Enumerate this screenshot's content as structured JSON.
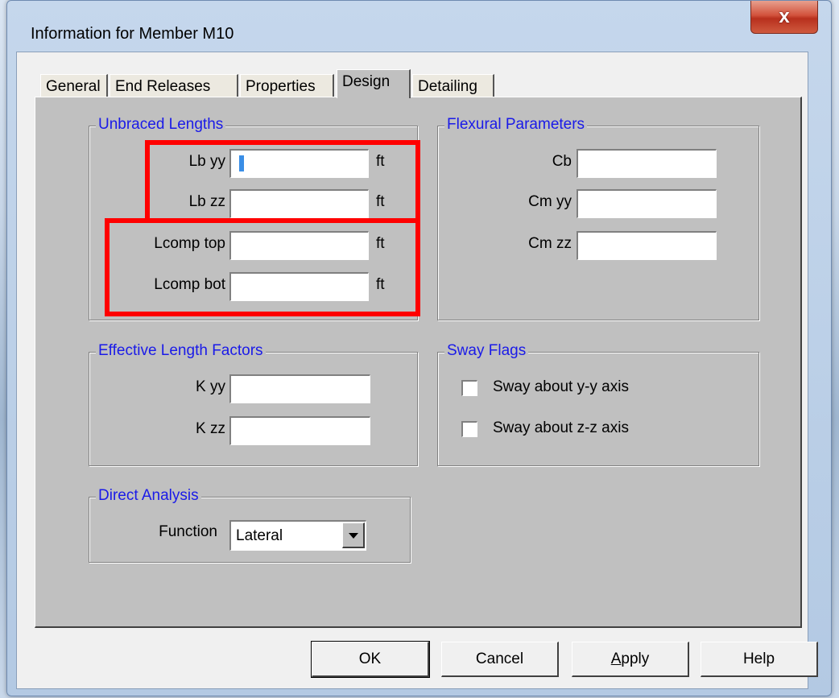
{
  "window": {
    "title": "Information for Member M10",
    "close_glyph": "x"
  },
  "tabs": [
    {
      "label": "General"
    },
    {
      "label": "End Releases"
    },
    {
      "label": "Properties"
    },
    {
      "label": "Design",
      "active": true
    },
    {
      "label": "Detailing"
    }
  ],
  "unbraced": {
    "title": "Unbraced Lengths",
    "lb_yy": {
      "label": "Lb yy",
      "value": "",
      "unit": "ft"
    },
    "lb_zz": {
      "label": "Lb zz",
      "value": "",
      "unit": "ft"
    },
    "lcomp_top": {
      "label": "Lcomp top",
      "value": "",
      "unit": "ft"
    },
    "lcomp_bot": {
      "label": "Lcomp bot",
      "value": "",
      "unit": "ft"
    }
  },
  "flexural": {
    "title": "Flexural Parameters",
    "cb": {
      "label": "Cb",
      "value": ""
    },
    "cm_yy": {
      "label": "Cm yy",
      "value": ""
    },
    "cm_zz": {
      "label": "Cm zz",
      "value": ""
    }
  },
  "effective": {
    "title": "Effective Length Factors",
    "k_yy": {
      "label": "K yy",
      "value": ""
    },
    "k_zz": {
      "label": "K zz",
      "value": ""
    }
  },
  "sway": {
    "title": "Sway Flags",
    "yy": {
      "label": "Sway about y-y axis",
      "checked": false
    },
    "zz": {
      "label": "Sway about z-z axis",
      "checked": false
    }
  },
  "direct": {
    "title": "Direct Analysis",
    "function_label": "Function",
    "function_value": "Lateral"
  },
  "buttons": {
    "ok": "OK",
    "cancel": "Cancel",
    "apply_a": "A",
    "apply_rest": "pply",
    "help": "Help"
  },
  "colors": {
    "highlight": "#ff0000",
    "group_title": "#1a1ae8",
    "panel": "#c0c0c0"
  }
}
